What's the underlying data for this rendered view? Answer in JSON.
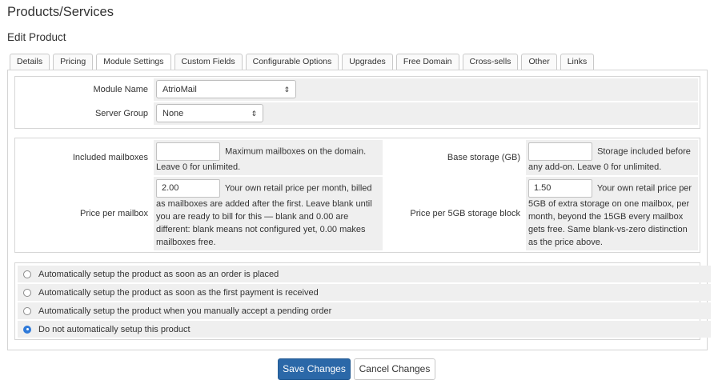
{
  "page": {
    "title": "Products/Services",
    "subtitle": "Edit Product"
  },
  "tabs": [
    {
      "label": "Details"
    },
    {
      "label": "Pricing"
    },
    {
      "label": "Module Settings",
      "active": true
    },
    {
      "label": "Custom Fields"
    },
    {
      "label": "Configurable Options"
    },
    {
      "label": "Upgrades"
    },
    {
      "label": "Free Domain"
    },
    {
      "label": "Cross-sells"
    },
    {
      "label": "Other"
    },
    {
      "label": "Links"
    }
  ],
  "module": {
    "module_name_label": "Module Name",
    "module_name_value": "AtrioMail",
    "server_group_label": "Server Group",
    "server_group_value": "None"
  },
  "config": {
    "included_mailboxes": {
      "label": "Included mailboxes",
      "value": "",
      "help_inline": "Maximum mailboxes on the domain.",
      "help_rest": "Leave 0 for unlimited."
    },
    "base_storage": {
      "label": "Base storage (GB)",
      "value": "",
      "help_inline": "Storage included before",
      "help_rest": "any add-on. Leave 0 for unlimited."
    },
    "price_per_mailbox": {
      "label": "Price per mailbox",
      "value": "2.00",
      "help_inline": "Your own retail price per",
      "help_rest": "month, billed as mailboxes are added after the first. Leave blank until you are ready to bill for this — blank and 0.00 are different: blank means not configured yet, 0.00 makes mailboxes free."
    },
    "price_per_storage_block": {
      "label": "Price per 5GB storage block",
      "value": "1.50",
      "help_inline": "Your own retail price",
      "help_rest": "per 5GB of extra storage on one mailbox, per month, beyond the 15GB every mailbox gets free. Same blank-vs-zero distinction as the price above."
    }
  },
  "autosetup": {
    "options": [
      {
        "label": "Automatically setup the product as soon as an order is placed",
        "checked": false
      },
      {
        "label": "Automatically setup the product as soon as the first payment is received",
        "checked": false
      },
      {
        "label": "Automatically setup the product when you manually accept a pending order",
        "checked": false
      },
      {
        "label": "Do not automatically setup this product",
        "checked": true
      }
    ]
  },
  "buttons": {
    "save": "Save Changes",
    "cancel": "Cancel Changes"
  },
  "colors": {
    "primary": "#2b68a8",
    "radio_checked": "#2f7ad9",
    "field_bg": "#efefef"
  }
}
